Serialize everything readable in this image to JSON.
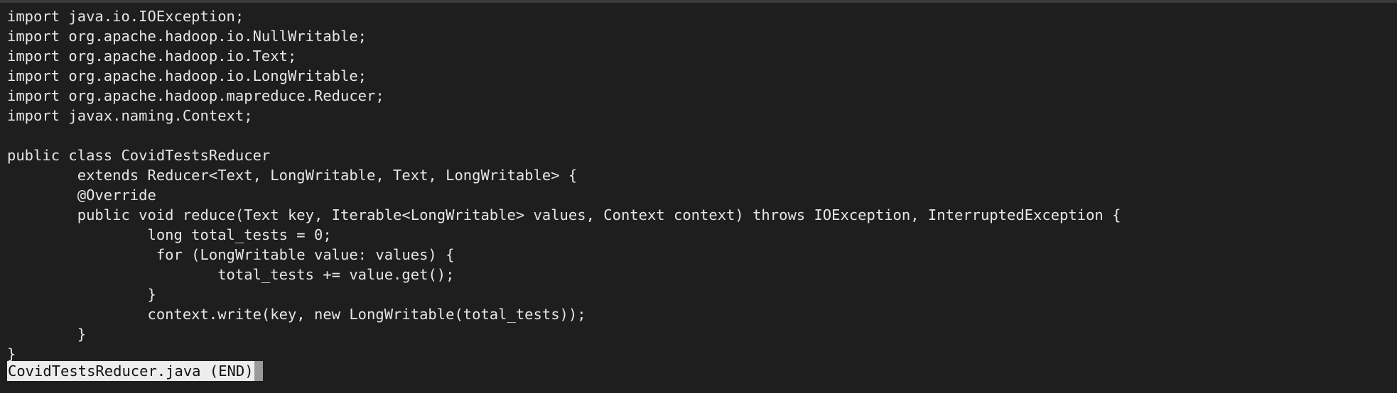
{
  "terminal": {
    "lines": [
      "import java.io.IOException;",
      "import org.apache.hadoop.io.NullWritable;",
      "import org.apache.hadoop.io.Text;",
      "import org.apache.hadoop.io.LongWritable;",
      "import org.apache.hadoop.mapreduce.Reducer;",
      "import javax.naming.Context;",
      "",
      "public class CovidTestsReducer",
      "        extends Reducer<Text, LongWritable, Text, LongWritable> {",
      "        @Override",
      "        public void reduce(Text key, Iterable<LongWritable> values, Context context) throws IOException, InterruptedException {",
      "                long total_tests = 0;",
      "                 for (LongWritable value: values) {",
      "                        total_tests += value.get();",
      "                }",
      "                context.write(key, new LongWritable(total_tests));",
      "        }",
      "}"
    ],
    "status": "CovidTestsReducer.java (END)",
    "colors": {
      "background": "#1e1e1e",
      "foreground": "#e6e6e6",
      "status_background": "#ededed",
      "status_foreground": "#111111",
      "cursor": "#9a9a9a"
    }
  }
}
